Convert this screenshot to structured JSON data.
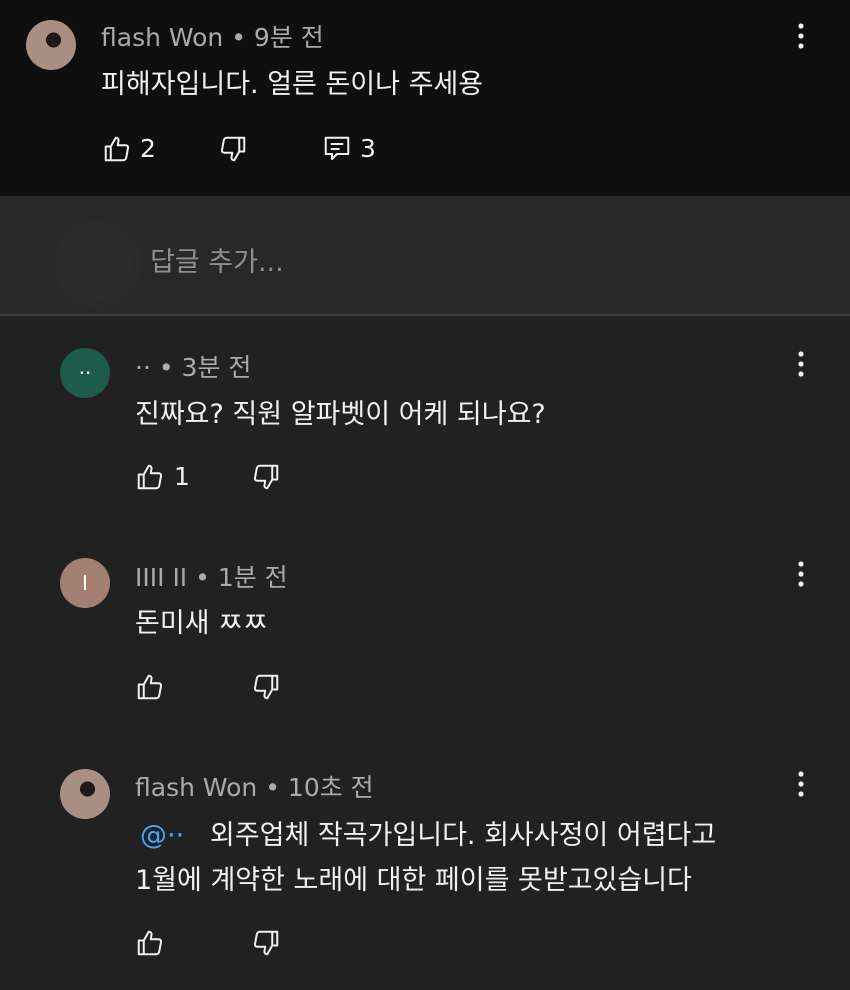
{
  "top_comment": {
    "author": "flash Won",
    "time": "9분 전",
    "text": "피해자입니다. 얼른 돈이나 주세용",
    "likes": "2",
    "replies": "3"
  },
  "reply_input": {
    "placeholder": "답글 추가..."
  },
  "replies": [
    {
      "author": "··",
      "time": "3분 전",
      "text": "진짜요? 직원 알파벳이 어케 되나요?",
      "likes": "1",
      "avatar_letter": "··",
      "avatar_color": "#1d5b4b"
    },
    {
      "author": "IIII II",
      "time": "1분 전",
      "text": "돈미새 ㅉㅉ",
      "likes": "",
      "avatar_letter": "I",
      "avatar_color": "#a27f71"
    },
    {
      "author": "flash Won",
      "time": "10초 전",
      "mention": "@··",
      "text_line1": "외주업체 작곡가입니다. 회사사정이 어렵다고",
      "text_line2": "1월에 계약한 노래에 대한 페이를 못받고있습니다",
      "likes": ""
    }
  ],
  "colors": {
    "background": "#212121",
    "top_background": "#0f0f0f",
    "mention": "#3ea6ff"
  }
}
